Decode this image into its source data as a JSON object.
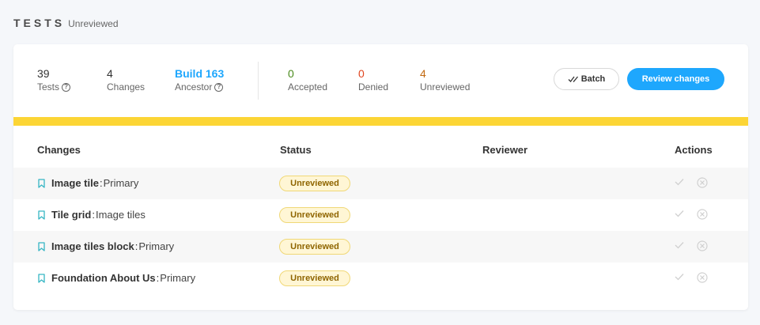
{
  "header": {
    "title": "TESTS",
    "subtitle": "Unreviewed"
  },
  "stats": {
    "tests": {
      "value": "39",
      "label": "Tests"
    },
    "changes": {
      "value": "4",
      "label": "Changes"
    },
    "ancestor": {
      "value": "Build 163",
      "label": "Ancestor"
    },
    "accepted": {
      "value": "0",
      "label": "Accepted"
    },
    "denied": {
      "value": "0",
      "label": "Denied"
    },
    "unreviewed": {
      "value": "4",
      "label": "Unreviewed"
    }
  },
  "buttons": {
    "batch": "Batch",
    "review": "Review changes"
  },
  "progress": {
    "reviewed_fraction": 0.0
  },
  "table": {
    "headers": {
      "changes": "Changes",
      "status": "Status",
      "reviewer": "Reviewer",
      "actions": "Actions"
    },
    "rows": [
      {
        "name": "Image tile",
        "variant": "Primary",
        "status": "Unreviewed"
      },
      {
        "name": "Tile grid",
        "variant": "Image tiles",
        "status": "Unreviewed"
      },
      {
        "name": "Image tiles block",
        "variant": "Primary",
        "status": "Unreviewed"
      },
      {
        "name": "Foundation About Us",
        "variant": "Primary",
        "status": "Unreviewed"
      }
    ]
  },
  "colors": {
    "accent_blue": "#1ea7fd",
    "accepted_green": "#4a8a1c",
    "denied_red": "#e0451f",
    "unreviewed_orange": "#c26a12",
    "progress_yellow": "#fcd535",
    "bookmark_teal": "#37b6c4"
  },
  "icons": {
    "help": "help-circle-icon",
    "bookmark": "bookmark-icon",
    "batch": "double-check-icon",
    "accept": "check-icon",
    "deny": "close-circle-icon"
  }
}
